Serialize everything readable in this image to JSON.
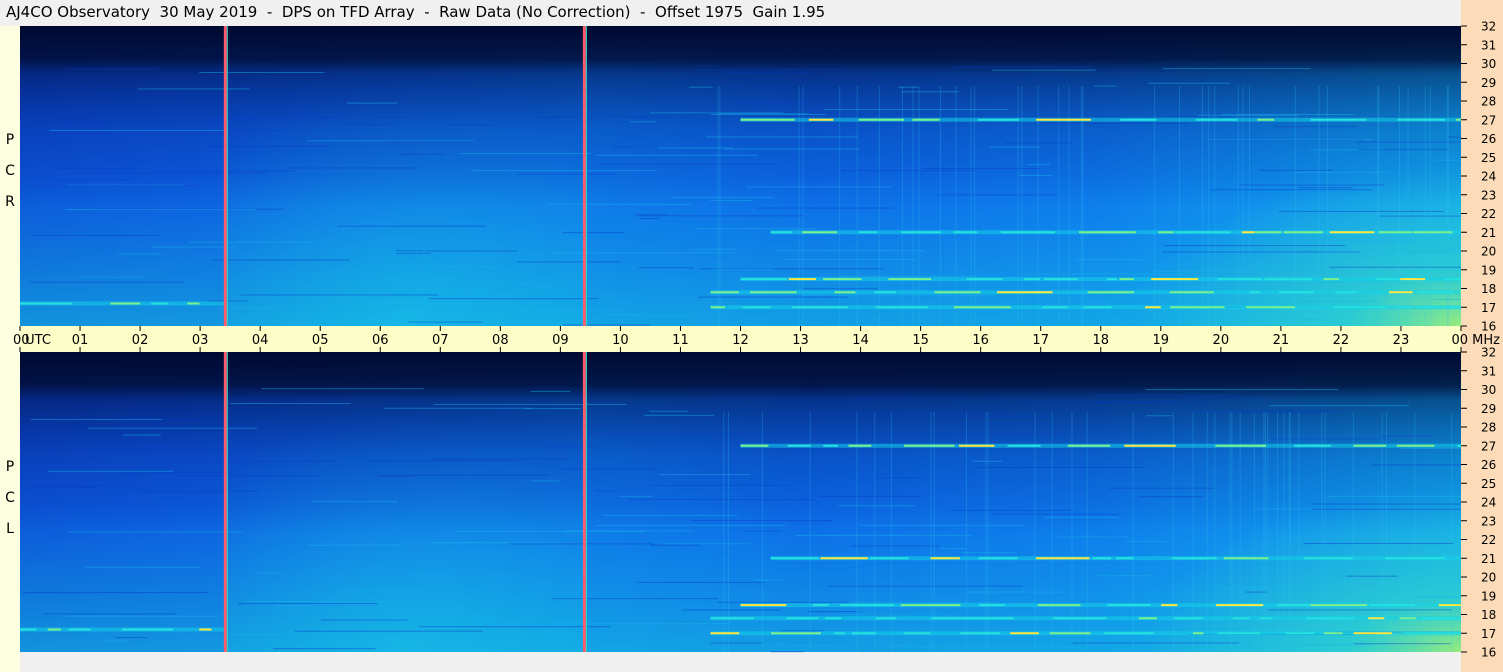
{
  "title": "AJ4CO Observatory  30 May 2019  -  DPS on TFD Array  -  Raw Data (No Correction)  -  Offset 1975  Gain 1.95",
  "panels": {
    "top": {
      "label_letters": [
        "R",
        "C",
        "P"
      ]
    },
    "bottom": {
      "label_letters": [
        "L",
        "C",
        "P"
      ]
    }
  },
  "colors": {
    "background": "#f0f0f0",
    "time_axis_band": "#fdfdc8",
    "freq_axis_band": "#fcdcb8",
    "marker_line": "#ff5a6e",
    "low_level": "#000a30",
    "mid_level": "#0a5ff0",
    "high_level": "#14c8e6",
    "peak_level": "#ffe640"
  },
  "chart_data": {
    "type": "heatmap",
    "title": "AJ4CO Observatory  30 May 2019  -  DPS on TFD Array  -  Raw Data (No Correction)  -  Offset 1975  Gain 1.95",
    "x_unit": "UTC",
    "y_unit": "MHz",
    "x_tick_labels": [
      "00",
      "01",
      "02",
      "03",
      "04",
      "05",
      "06",
      "07",
      "08",
      "09",
      "10",
      "11",
      "12",
      "13",
      "14",
      "15",
      "16",
      "17",
      "18",
      "19",
      "20",
      "21",
      "22",
      "23",
      "00"
    ],
    "x_range_hours": [
      0,
      24
    ],
    "y_tick_labels": [
      "32",
      "31",
      "30",
      "29",
      "28",
      "27",
      "26",
      "25",
      "24",
      "23",
      "22",
      "21",
      "20",
      "19",
      "18",
      "17",
      "16"
    ],
    "y_range_mhz": [
      16,
      32
    ],
    "markers_utc_hours": [
      3.42,
      9.4
    ],
    "panels": [
      "RCP",
      "LCP"
    ],
    "features": [
      {
        "desc": "strong band",
        "freq_mhz": 27.0,
        "utc_from": 12.0,
        "utc_to": 24.0
      },
      {
        "desc": "band",
        "freq_mhz": 17.0,
        "utc_from": 11.5,
        "utc_to": 24.0
      },
      {
        "desc": "band",
        "freq_mhz": 17.8,
        "utc_from": 11.5,
        "utc_to": 24.0
      },
      {
        "desc": "band",
        "freq_mhz": 21.0,
        "utc_from": 12.5,
        "utc_to": 24.0
      },
      {
        "desc": "band",
        "freq_mhz": 18.5,
        "utc_from": 12.0,
        "utc_to": 24.0
      },
      {
        "desc": "band",
        "freq_mhz": 17.2,
        "utc_from": 0.0,
        "utc_to": 3.4
      }
    ]
  }
}
